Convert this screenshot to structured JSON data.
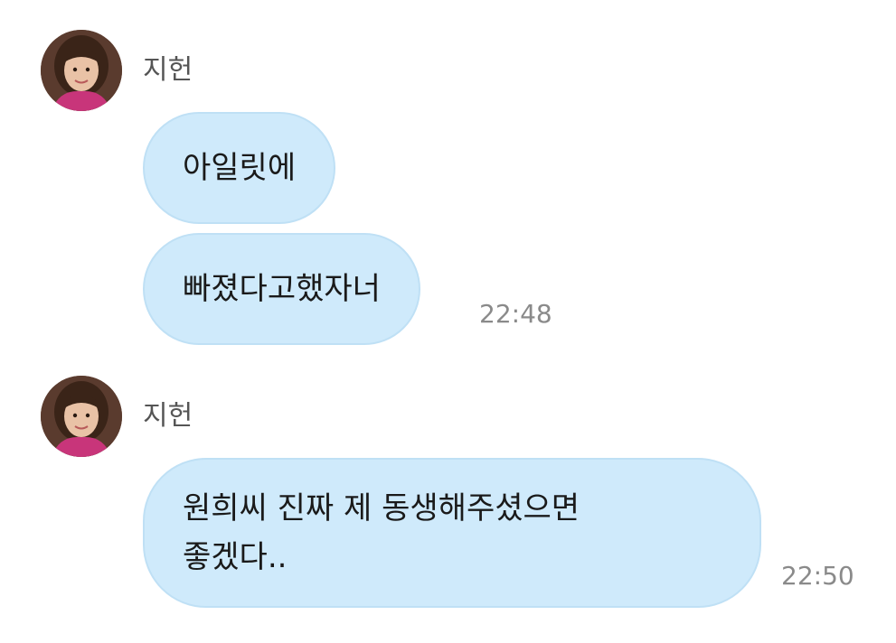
{
  "chat": {
    "groups": [
      {
        "sender": "지헌",
        "messages": [
          {
            "text": "아일릿에"
          },
          {
            "text": "빠졌다고했자너"
          }
        ],
        "time": "22:48"
      },
      {
        "sender": "지헌",
        "messages": [
          {
            "text": "원희씨 진짜 제 동생해주셨으면\n좋겠다.."
          }
        ],
        "time": "22:50"
      }
    ]
  },
  "colors": {
    "bubble": "#cfeafb",
    "bubble_border": "#bfe0f5",
    "name": "#555555",
    "timestamp": "#8a8a8a",
    "text": "#1a1a1a"
  },
  "icons": {
    "avatar": "user-photo-avatar"
  }
}
